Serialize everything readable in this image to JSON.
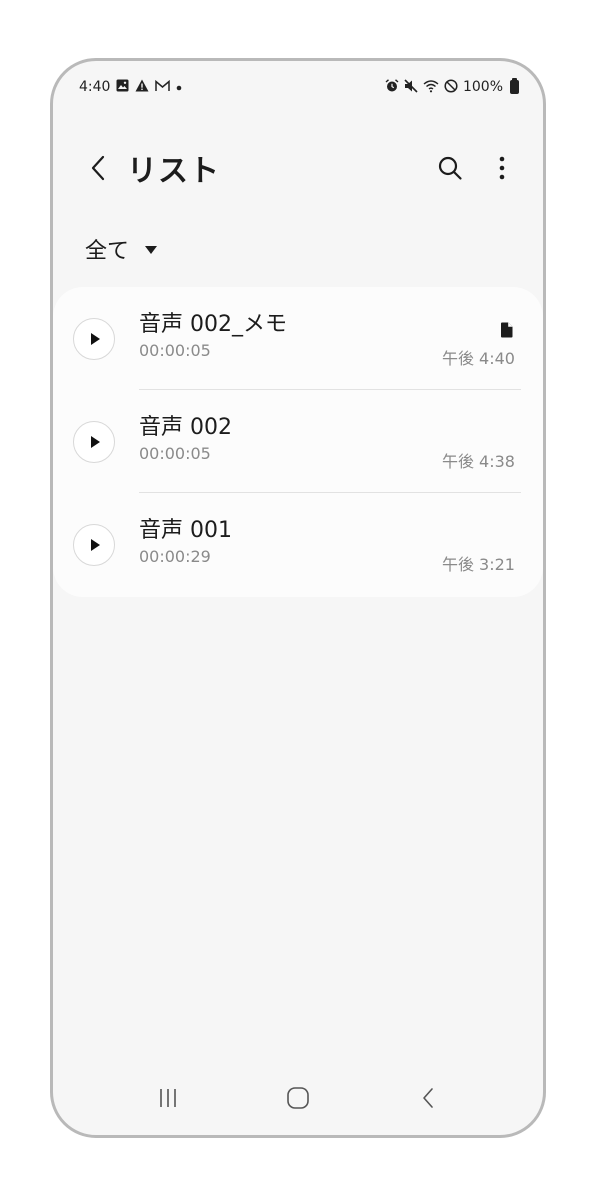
{
  "status_bar": {
    "time": "4:40",
    "battery": "100%",
    "icons_left": [
      "image-icon",
      "warning-icon",
      "mail-icon",
      "dot-icon"
    ],
    "icons_right": [
      "alarm-icon",
      "mute-icon",
      "wifi-icon",
      "do-not-disturb-icon",
      "battery-icon"
    ]
  },
  "header": {
    "title": "リスト",
    "back_icon": "chevron-left-icon",
    "actions": [
      "search-icon",
      "more-vertical-icon"
    ]
  },
  "filter": {
    "label": "全て"
  },
  "recordings": [
    {
      "title": "音声 002_メモ",
      "duration": "00:00:05",
      "time": "午後 4:40",
      "has_memo": true
    },
    {
      "title": "音声 002",
      "duration": "00:00:05",
      "time": "午後 4:38",
      "has_memo": false
    },
    {
      "title": "音声 001",
      "duration": "00:00:29",
      "time": "午後 3:21",
      "has_memo": false
    }
  ],
  "nav": [
    "recent-apps-icon",
    "home-icon",
    "back-icon"
  ],
  "colors": {
    "background": "#f6f6f6",
    "card": "#fcfcfc",
    "secondary_text": "#8a8a8a",
    "primary_text": "#1c1c1c"
  }
}
